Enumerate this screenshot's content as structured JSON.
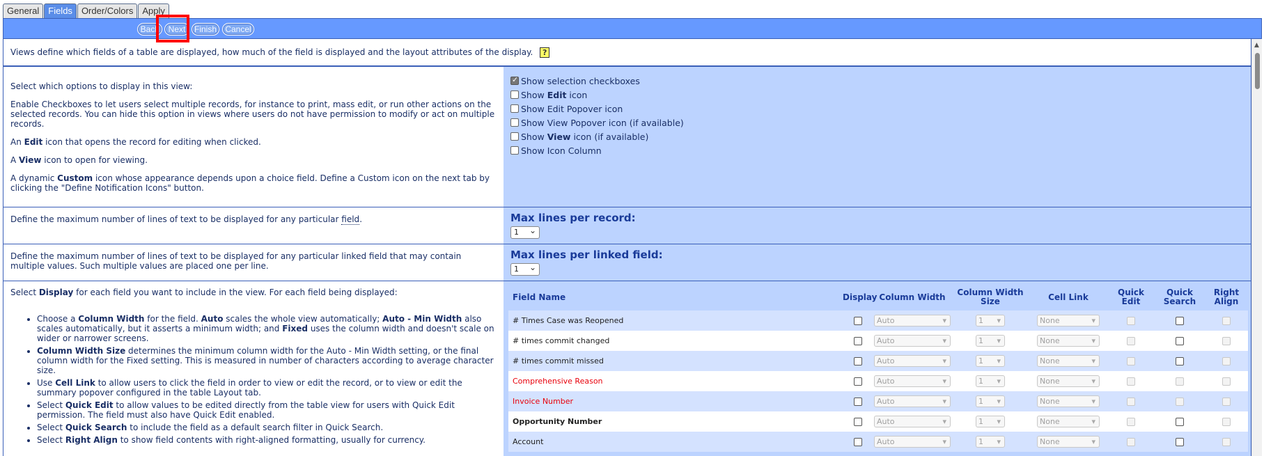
{
  "tabs": [
    "General",
    "Fields",
    "Order/Colors",
    "Apply"
  ],
  "wizard": {
    "back": "Back",
    "next": "Next",
    "finish": "Finish",
    "cancel": "Cancel"
  },
  "intro": {
    "text": "Views define which fields of a table are displayed, how much of the field is displayed and the layout attributes of the display.",
    "help_icon": "?"
  },
  "options_section": {
    "heading": "Select which options to display in this view:",
    "p_checkbox": "Enable Checkboxes to let users select multiple records, for instance to print, mass edit, or run other actions on the selected records. You can hide this option in views where users do not have permission to modify or act on multiple records.",
    "p_edit_pre": "An ",
    "p_edit_b": "Edit",
    "p_edit_post": " icon that opens the record for editing when clicked.",
    "p_view_pre": "A ",
    "p_view_b": "View",
    "p_view_post": " icon to open for viewing.",
    "p_custom_pre": "A dynamic ",
    "p_custom_b": "Custom",
    "p_custom_post": " icon whose appearance depends upon a choice field. Define a Custom icon on the next tab by clicking the \"Define Notification Icons\" button.",
    "checkboxes": [
      {
        "pre": "Show selection checkboxes",
        "bold": "",
        "post": "",
        "checked": true
      },
      {
        "pre": "Show ",
        "bold": "Edit",
        "post": " icon",
        "checked": false
      },
      {
        "pre": "Show Edit Popover icon",
        "bold": "",
        "post": "",
        "checked": false
      },
      {
        "pre": "Show View Popover icon (if available)",
        "bold": "",
        "post": "",
        "checked": false
      },
      {
        "pre": "Show ",
        "bold": "View",
        "post": " icon (if available)",
        "checked": false
      },
      {
        "pre": "Show Icon Column",
        "bold": "",
        "post": "",
        "checked": false
      }
    ]
  },
  "max_lines": {
    "desc_pre": "Define the maximum number of lines of text to be displayed for any particular ",
    "desc_link": "field",
    "desc_post": ".",
    "label": "Max lines per record:",
    "value": "1"
  },
  "max_linked": {
    "desc": "Define the maximum number of lines of text to be displayed for any particular linked field that may contain multiple values. Such multiple values are placed one per line.",
    "label": "Max lines per linked field:",
    "value": "1"
  },
  "fields_help": {
    "intro_pre": "Select ",
    "intro_b": "Display",
    "intro_post": " for each field you want to include in the view. For each field being displayed:",
    "b1": {
      "t1": "Choose a ",
      "b1": "Column Width",
      "t2": " for the field. ",
      "b2": "Auto",
      "t3": " scales the whole view automatically; ",
      "b3": "Auto - Min Width",
      "t4": " also scales automatically, but it asserts a minimum width; and ",
      "b4": "Fixed",
      "t5": " uses the column width and doesn't scale on wider or narrower screens."
    },
    "b2": {
      "b": "Column Width Size",
      "t": " determines the minimum column width for the Auto - Min Width setting, or the final column width for the Fixed setting. This is measured in number of characters according to average character size."
    },
    "b3": {
      "pre": "Use ",
      "b": "Cell Link",
      "t": " to allow users to click the field in order to view or edit the record, or to view or edit the summary popover configured in the table Layout tab."
    },
    "b4": {
      "pre": "Select ",
      "b": "Quick Edit",
      "t": " to allow values to be edited directly from the table view for users with Quick Edit permission. The field must also have Quick Edit enabled."
    },
    "b5": {
      "pre": "Select ",
      "b": "Quick Search",
      "t": " to include the field as a default search filter in Quick Search."
    },
    "b6": {
      "pre": "Select ",
      "b": "Right Align",
      "t": " to show field contents with right-aligned formatting, usually for currency."
    }
  },
  "fields_table": {
    "headers": [
      "Field Name",
      "Display",
      "Column Width",
      "Column Width Size",
      "Cell Link",
      "Quick Edit",
      "Quick Search",
      "Right Align"
    ],
    "rows": [
      {
        "name": "# Times Case was Reopened",
        "style": "normal",
        "width": "Auto",
        "size": "1",
        "link": "None",
        "quick_search_enabled": true
      },
      {
        "name": "# times commit changed",
        "style": "normal",
        "width": "Auto",
        "size": "1",
        "link": "None",
        "quick_search_enabled": true
      },
      {
        "name": "# times commit missed",
        "style": "normal",
        "width": "Auto",
        "size": "1",
        "link": "None",
        "quick_search_enabled": true
      },
      {
        "name": "Comprehensive Reason",
        "style": "red",
        "width": "Auto",
        "size": "1",
        "link": "None",
        "quick_search_enabled": false
      },
      {
        "name": "Invoice Number",
        "style": "red",
        "width": "Auto",
        "size": "1",
        "link": "None",
        "quick_search_enabled": false
      },
      {
        "name": "Opportunity Number",
        "style": "bold",
        "width": "Auto",
        "size": "1",
        "link": "None",
        "quick_search_enabled": true
      },
      {
        "name": "Account",
        "style": "normal",
        "width": "Auto",
        "size": "1",
        "link": "None",
        "quick_search_enabled": true
      }
    ]
  },
  "colors": {
    "accent": "#6699ff",
    "panel": "#bcd3ff",
    "required_field": "#e8000b",
    "highlight": "#ff0000"
  }
}
